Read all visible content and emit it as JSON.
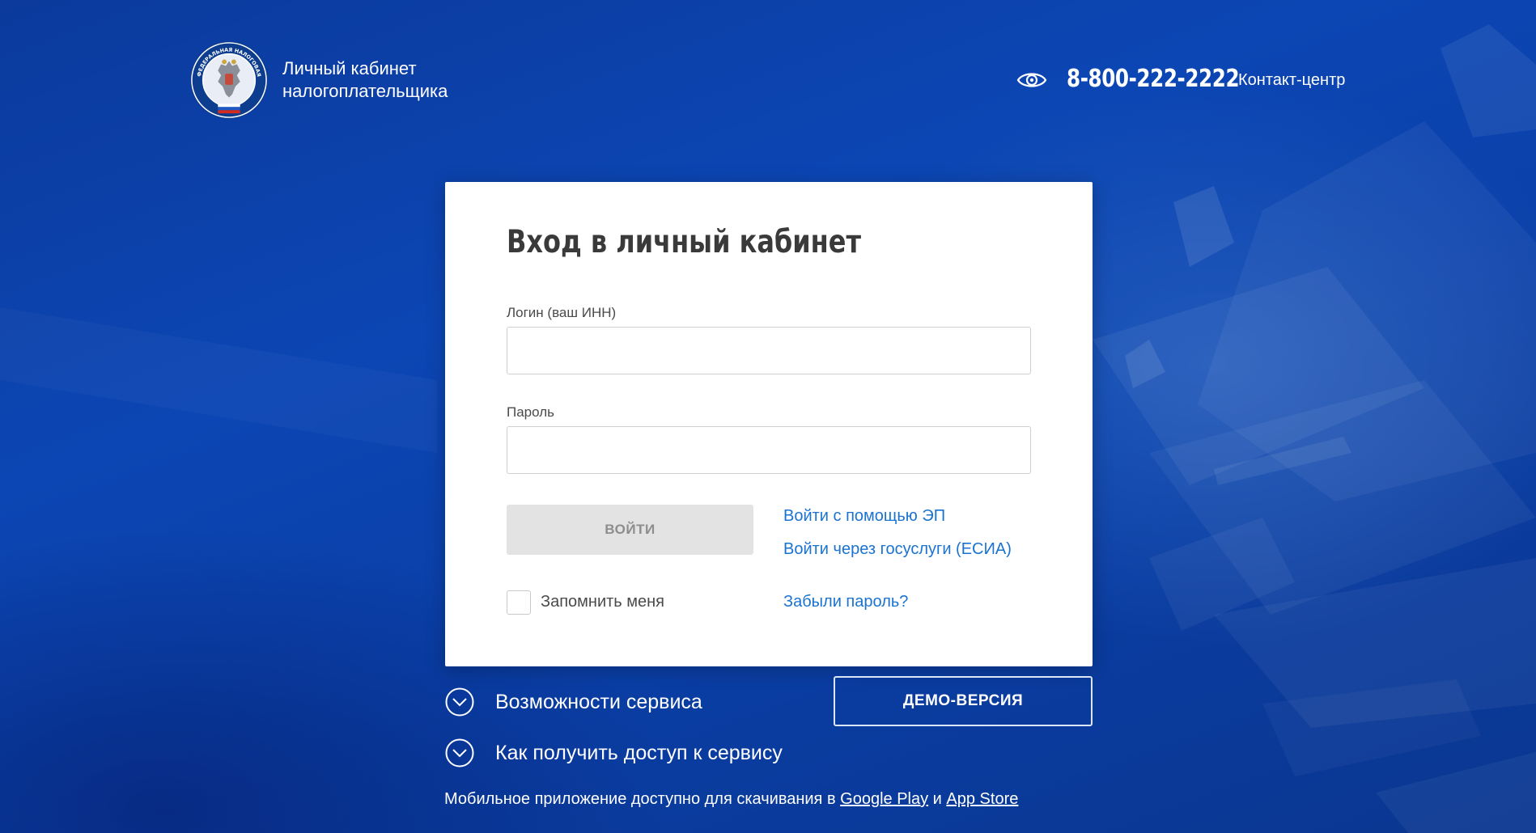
{
  "header": {
    "logo_ring_text": "ФЕДЕРАЛЬНАЯ НАЛОГОВАЯ СЛУЖБА",
    "title_line1": "Личный кабинет",
    "title_line2": "налогоплательщика",
    "accessibility_icon": "eye-icon",
    "phone": "8-800-222-2222",
    "contact_center": "Контакт-центр"
  },
  "login_form": {
    "title": "Вход в личный кабинет",
    "login_label": "Логин (ваш ИНН)",
    "login_value": "",
    "password_label": "Пароль",
    "password_value": "",
    "submit_label": "ВОЙТИ",
    "sign_in_ep": "Войти с помощью ЭП",
    "sign_in_esia": "Войти через госуслуги (ЕСИА)",
    "remember_me": "Запомнить меня",
    "remember_checked": false,
    "forgot_password": "Забыли пароль?"
  },
  "info": {
    "features_label": "Возможности сервиса",
    "access_label": "Как получить доступ к сервису",
    "expander_icon": "chevron-down-circle-icon",
    "demo_button": "ДЕМО-ВЕРСИЯ"
  },
  "footer": {
    "mobile_text": "Мобильное приложение доступно для скачивания в",
    "google_play": "Google Play",
    "and": "и",
    "app_store": "App Store"
  },
  "colors": {
    "background": "#0c46b4",
    "link": "#1a73d0",
    "button_disabled": "#e3e3e3",
    "card": "#ffffff"
  }
}
